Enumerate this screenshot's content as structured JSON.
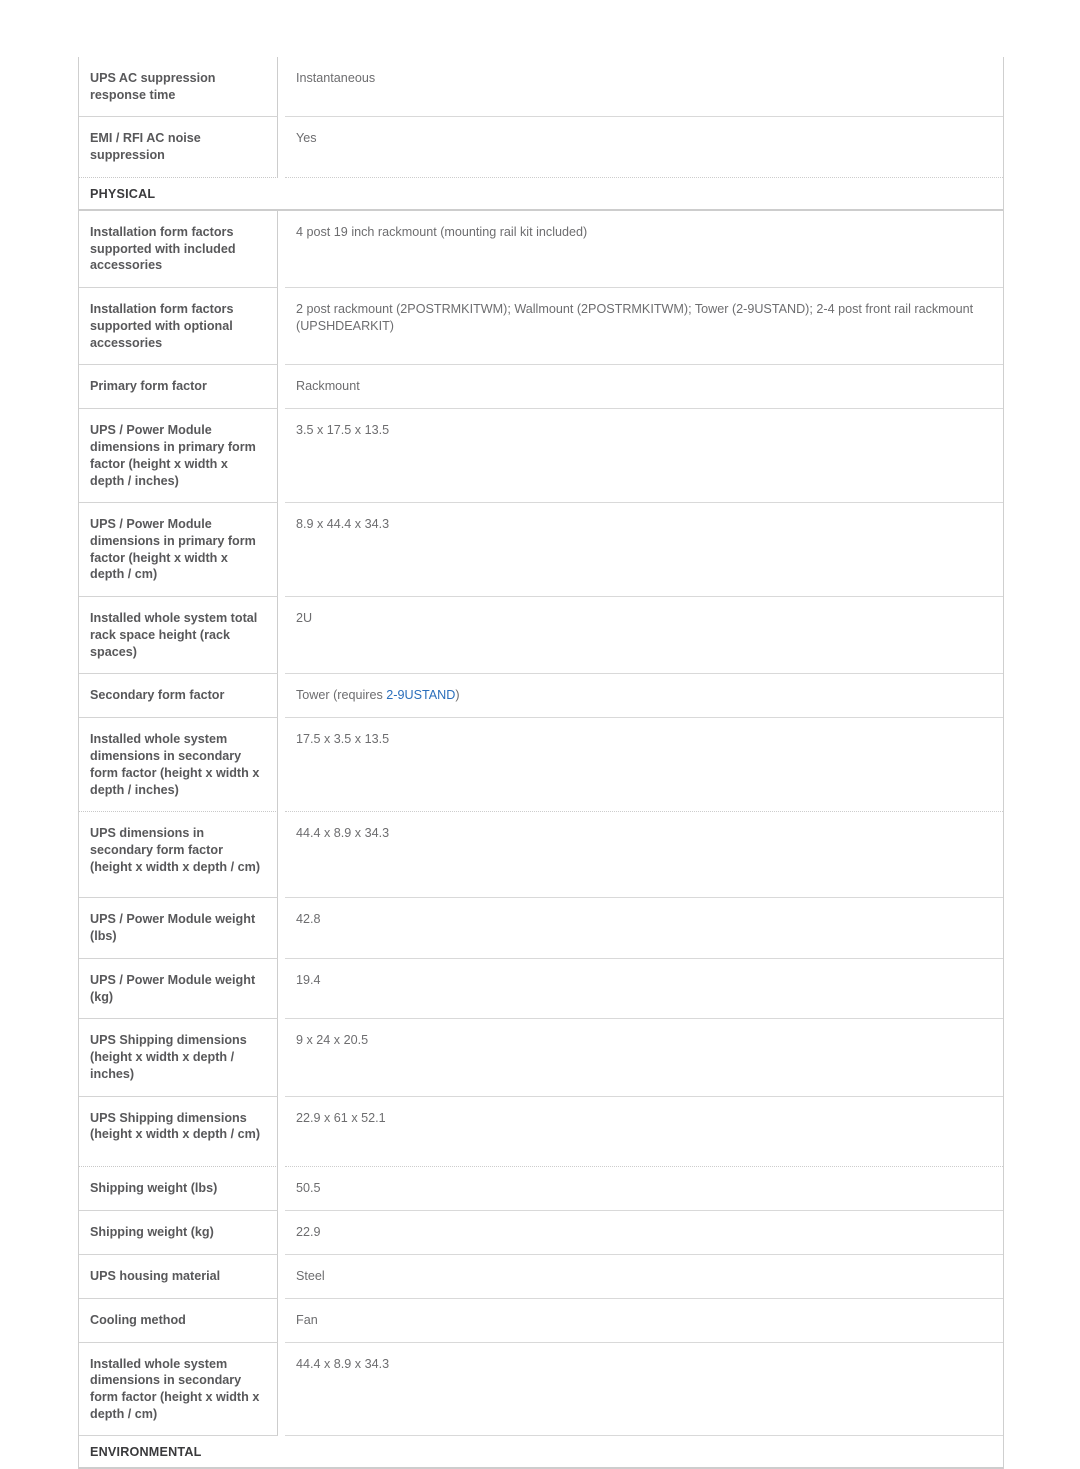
{
  "document": {
    "type": "product-specification-table",
    "colors": {
      "label_text": "#58585a",
      "value_text": "#6d6d6f",
      "section_text": "#3a3a3c",
      "link": "#2a6ebb",
      "border": "#cdcdcd",
      "background": "#ffffff"
    }
  },
  "rows": [
    {
      "kind": "spec",
      "label": "UPS AC suppression response time",
      "value": "Instantaneous",
      "min_height": 48,
      "separator": "solid"
    },
    {
      "kind": "spec",
      "label": "EMI / RFI AC noise suppression",
      "value": "Yes",
      "min_height": 48,
      "separator": "dotted"
    },
    {
      "kind": "section",
      "label": "PHYSICAL"
    },
    {
      "kind": "spec",
      "label": "Installation form factors supported with included accessories",
      "value": "4 post 19 inch rackmount (mounting rail kit included)",
      "min_height": 70,
      "separator": "solid"
    },
    {
      "kind": "spec",
      "label": "Installation form factors supported with optional accessories",
      "value": "2 post rackmount (2POSTRMKITWM); Wallmount (2POSTRMKITWM); Tower (2-9USTAND); 2-4 post front rail rackmount (UPSHDEARKIT)",
      "min_height": 70,
      "separator": "solid"
    },
    {
      "kind": "spec",
      "label": "Primary form factor",
      "value": "Rackmount",
      "min_height": 29,
      "separator": "solid"
    },
    {
      "kind": "spec",
      "label": "UPS / Power Module dimensions in primary form factor (height x width x depth / inches)",
      "value": "3.5 x 17.5 x 13.5",
      "min_height": 86,
      "separator": "solid"
    },
    {
      "kind": "spec",
      "label": "UPS / Power Module dimensions in primary form factor (height x width x depth / cm)",
      "value": "8.9 x 44.4 x 34.3",
      "min_height": 86,
      "separator": "solid"
    },
    {
      "kind": "spec",
      "label": "Installed whole system total rack space height (rack spaces)",
      "value": "2U",
      "min_height": 70,
      "separator": "solid"
    },
    {
      "kind": "spec",
      "label": "Secondary form factor",
      "value_prefix": "Tower (requires ",
      "value_link": "2-9USTAND",
      "value_suffix": ")",
      "min_height": 29,
      "separator": "solid",
      "has_link": true
    },
    {
      "kind": "spec",
      "label": "Installed whole system dimensions in secondary form factor (height x width x depth / inches)",
      "value": "17.5 x 3.5 x 13.5",
      "min_height": 86,
      "separator": "dotted"
    },
    {
      "kind": "spec",
      "label": "UPS dimensions in secondary form factor (height x width x depth / cm)",
      "value": "44.4 x 8.9 x 34.3",
      "min_height": 86,
      "separator": "solid"
    },
    {
      "kind": "spec",
      "label": "UPS / Power Module weight (lbs)",
      "value": "42.8",
      "min_height": 48,
      "separator": "solid"
    },
    {
      "kind": "spec",
      "label": "UPS / Power Module weight (kg)",
      "value": "19.4",
      "min_height": 48,
      "separator": "solid"
    },
    {
      "kind": "spec",
      "label": "UPS Shipping dimensions (height x width x depth / inches)",
      "value": "9 x 24 x 20.5",
      "min_height": 70,
      "separator": "solid"
    },
    {
      "kind": "spec",
      "label": "UPS Shipping dimensions (height x width x depth / cm)",
      "value": "22.9 x 61 x 52.1",
      "min_height": 70,
      "separator": "dotted"
    },
    {
      "kind": "spec",
      "label": "Shipping weight (lbs)",
      "value": "50.5",
      "min_height": 29,
      "separator": "solid"
    },
    {
      "kind": "spec",
      "label": "Shipping weight (kg)",
      "value": "22.9",
      "min_height": 29,
      "separator": "solid"
    },
    {
      "kind": "spec",
      "label": "UPS housing material",
      "value": "Steel",
      "min_height": 29,
      "separator": "solid"
    },
    {
      "kind": "spec",
      "label": "Cooling method",
      "value": "Fan",
      "min_height": 29,
      "separator": "solid"
    },
    {
      "kind": "spec",
      "label": "Installed whole system dimensions in secondary form factor (height x width x depth / cm)",
      "value": "44.4 x 8.9 x 34.3",
      "min_height": 86,
      "separator": "solid"
    },
    {
      "kind": "section",
      "label": "ENVIRONMENTAL"
    }
  ]
}
